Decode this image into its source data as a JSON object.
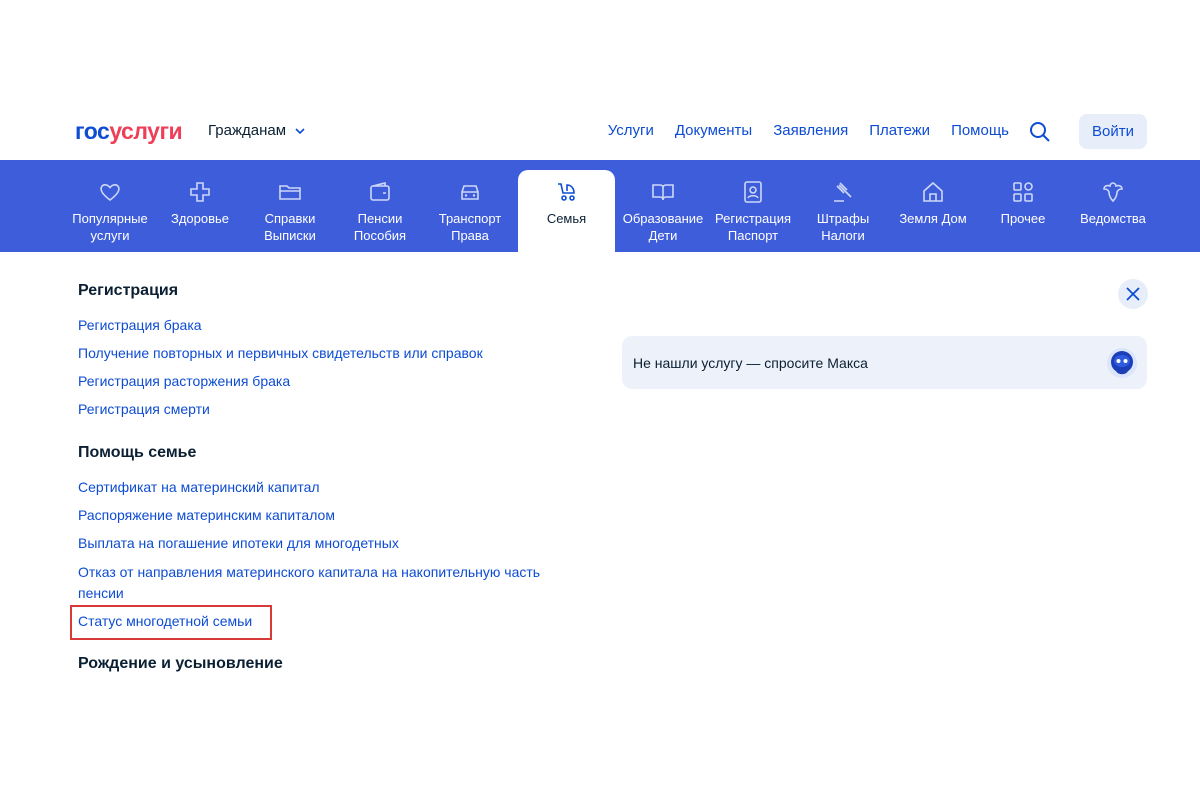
{
  "header": {
    "logo_part1": "гос",
    "logo_part2": "услуги",
    "audience": "Гражданам",
    "nav": [
      "Услуги",
      "Документы",
      "Заявления",
      "Платежи",
      "Помощь"
    ],
    "login": "Войти"
  },
  "categories": [
    {
      "label": "Популярные\nуслуги",
      "icon": "heart-icon"
    },
    {
      "label": "Здоровье",
      "icon": "cross-icon"
    },
    {
      "label": "Справки\nВыписки",
      "icon": "folder-icon"
    },
    {
      "label": "Пенсии\nПособия",
      "icon": "wallet-icon"
    },
    {
      "label": "Транспорт\nПрава",
      "icon": "car-icon"
    },
    {
      "label": "Семья",
      "icon": "stroller-icon",
      "active": true
    },
    {
      "label": "Образование\nДети",
      "icon": "book-icon"
    },
    {
      "label": "Регистрация\nПаспорт",
      "icon": "id-card-icon"
    },
    {
      "label": "Штрафы\nНалоги",
      "icon": "gavel-icon"
    },
    {
      "label": "Земля Дом",
      "icon": "house-icon"
    },
    {
      "label": "Прочее",
      "icon": "grid-icon"
    },
    {
      "label": "Ведомства",
      "icon": "emblem-icon"
    }
  ],
  "sections": {
    "registration": {
      "title": "Регистрация",
      "links": [
        "Регистрация брака",
        "Получение повторных и первичных свидетельств или справок",
        "Регистрация расторжения брака",
        "Регистрация смерти"
      ]
    },
    "family_help": {
      "title": "Помощь семье",
      "links": [
        "Сертификат на материнский капитал",
        "Распоряжение материнским капиталом",
        "Выплата на погашение ипотеки для многодетных",
        "Отказ от направления материнского капитала на накопительную часть пенсии",
        "Статус многодетной семьи"
      ]
    },
    "birth": {
      "title": "Рождение и усыновление"
    }
  },
  "assistant": {
    "prompt": "Не нашли услугу — спросите Макса"
  },
  "colors": {
    "brand_blue": "#0d4cd3",
    "brand_red": "#ee3f58",
    "band": "#3e5ddb",
    "highlight": "#d83a3a"
  }
}
